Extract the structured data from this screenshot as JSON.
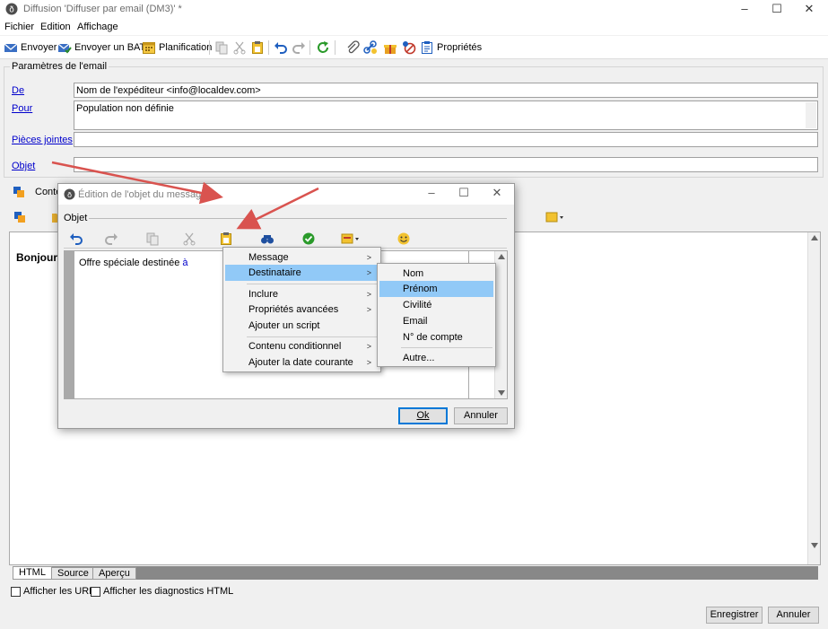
{
  "window": {
    "title": "Diffusion 'Diffuser par email (DM3)' *",
    "controls": [
      "minimize",
      "maximize",
      "close"
    ]
  },
  "menubar": {
    "items": [
      "Fichier",
      "Edition",
      "Affichage"
    ]
  },
  "toolbar": {
    "send_label": "Envoyer",
    "send_proof_label": "Envoyer un BAT",
    "schedule_label": "Planification",
    "properties_label": "Propriétés"
  },
  "params": {
    "legend": "Paramètres de l'email",
    "from_label": "De",
    "from_value": "Nom de l'expéditeur <info@localdev.com>",
    "to_label": "Pour",
    "to_value": "Population non définie",
    "attachments_label": "Pièces jointes",
    "subject_label": "Objet"
  },
  "content": {
    "tab_label": "Conte",
    "body_text": "Bonjour,",
    "editor_tabs": [
      "HTML",
      "Source",
      "Aperçu"
    ],
    "checkbox_urls": "Afficher les URL",
    "checkbox_diag": "Afficher les diagnostics HTML",
    "save_button": "Enregistrer",
    "cancel_button": "Annuler"
  },
  "dialog": {
    "title": "Édition de l'objet du message",
    "group_label": "Objet",
    "text_prefix": "Offre spéciale destinée ",
    "text_suffix": "à",
    "ok_button": "Ok",
    "cancel_button": "Annuler"
  },
  "menu_primary": {
    "items": [
      "Message",
      "Destinataire",
      "Inclure",
      "Propriétés avancées",
      "Ajouter un script",
      "Contenu conditionnel",
      "Ajouter la date courante"
    ],
    "highlighted": "Destinataire"
  },
  "menu_secondary": {
    "items": [
      "Nom",
      "Prénom",
      "Civilité",
      "Email",
      "N° de compte",
      "Autre..."
    ],
    "highlighted": "Prénom"
  },
  "colors": {
    "highlight": "#91c9f7",
    "link": "#0000cc",
    "arrow": "#d9534f"
  }
}
